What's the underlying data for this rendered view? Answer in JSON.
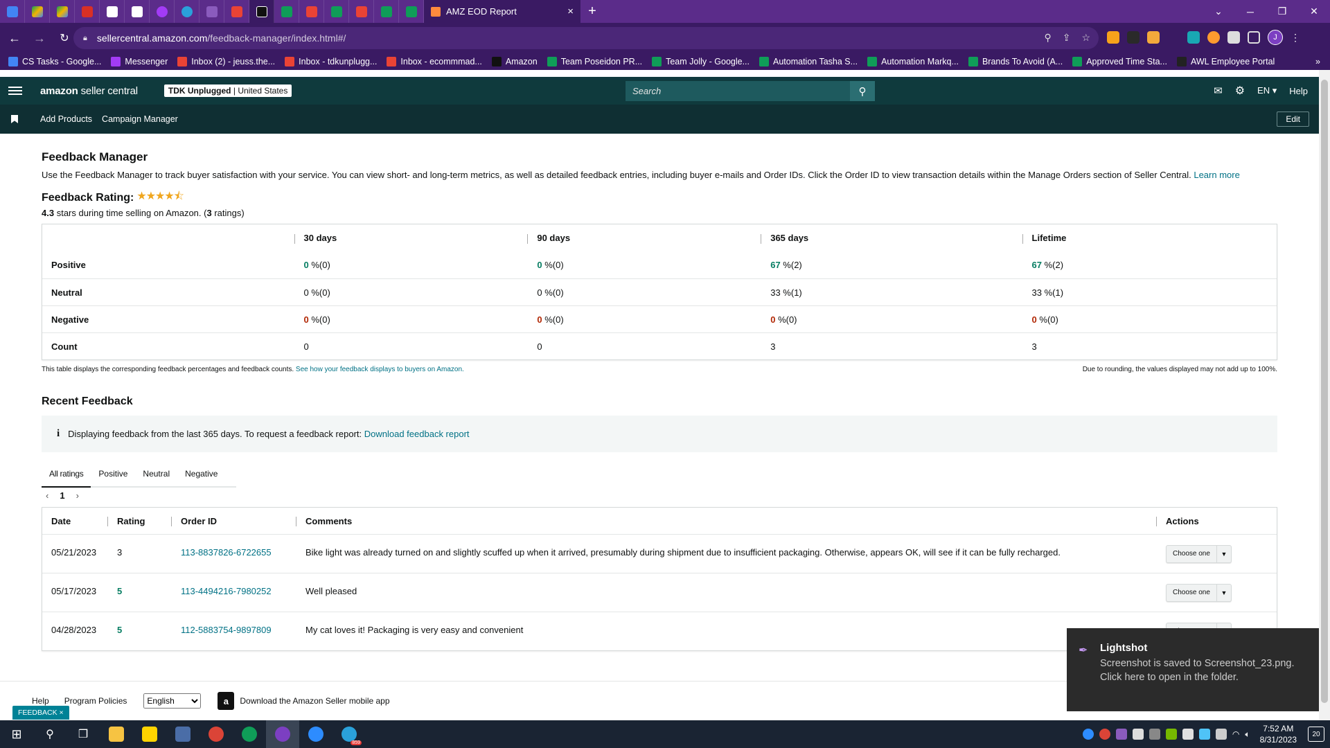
{
  "browser": {
    "active_tab_title": "AMZ EOD Report",
    "url_host": "sellercentral.amazon.com",
    "url_path": "/feedback-manager/index.html#/",
    "bookmarks": [
      {
        "label": "CS Tasks - Google...",
        "icon": "google-docs-icon",
        "color": "#4285f4"
      },
      {
        "label": "Messenger",
        "icon": "messenger-icon",
        "color": "#a33bf6"
      },
      {
        "label": "Inbox (2) - jeuss.the...",
        "icon": "gmail-icon",
        "color": "#ea4335"
      },
      {
        "label": "Inbox - tdkunplugg...",
        "icon": "gmail-icon",
        "color": "#ea4335"
      },
      {
        "label": "Inbox - ecommmad...",
        "icon": "gmail-icon",
        "color": "#ea4335"
      },
      {
        "label": "Amazon",
        "icon": "amazon-icon",
        "color": "#111111"
      },
      {
        "label": "Team Poseidon PR...",
        "icon": "google-sheets-icon",
        "color": "#0f9d58"
      },
      {
        "label": "Team Jolly - Google...",
        "icon": "google-sheets-icon",
        "color": "#0f9d58"
      },
      {
        "label": "Automation Tasha S...",
        "icon": "google-sheets-icon",
        "color": "#0f9d58"
      },
      {
        "label": "Automation Markq...",
        "icon": "google-sheets-icon",
        "color": "#0f9d58"
      },
      {
        "label": "Brands To Avoid (A...",
        "icon": "google-sheets-icon",
        "color": "#0f9d58"
      },
      {
        "label": "Approved Time Sta...",
        "icon": "google-sheets-icon",
        "color": "#0f9d58"
      },
      {
        "label": "AWL Employee Portal",
        "icon": "awl-icon",
        "color": "#222222"
      }
    ],
    "profile_initial": "J"
  },
  "header": {
    "logo_bold": "amazon",
    "logo_rest": " seller central",
    "store_name": "TDK Unplugged",
    "store_region": "United States",
    "search_placeholder": "Search",
    "lang": "EN",
    "help": "Help",
    "nav_links": [
      "Add Products",
      "Campaign Manager"
    ],
    "edit": "Edit"
  },
  "page": {
    "title": "Feedback Manager",
    "description": "Use the Feedback Manager to track buyer satisfaction with your service. You can view short- and long-term metrics, as well as detailed feedback entries, including buyer e-mails and Order IDs. Click the Order ID to view transaction details within the Manage Orders section of Seller Central.",
    "learn_more": "Learn more",
    "rating_label": "Feedback Rating:",
    "stars": "★★★★⯪",
    "rating_value": "4.3",
    "rating_text": "stars during time selling on Amazon. (",
    "rating_count": "3",
    "rating_text_end": " ratings)",
    "rating_stars_value": 4.3
  },
  "metrics": {
    "columns": [
      "30 days",
      "90 days",
      "365 days",
      "Lifetime"
    ],
    "rows": [
      {
        "label": "Positive",
        "cells": [
          {
            "n": "0",
            "rest": " %(0)",
            "tone": "g"
          },
          {
            "n": "0",
            "rest": " %(0)",
            "tone": "g"
          },
          {
            "n": "67",
            "rest": " %(2)",
            "tone": "g"
          },
          {
            "n": "67",
            "rest": " %(2)",
            "tone": "g"
          }
        ]
      },
      {
        "label": "Neutral",
        "cells": [
          {
            "n": "0",
            "rest": " %(0)",
            "tone": ""
          },
          {
            "n": "0",
            "rest": " %(0)",
            "tone": ""
          },
          {
            "n": "33",
            "rest": " %(1)",
            "tone": ""
          },
          {
            "n": "33",
            "rest": " %(1)",
            "tone": ""
          }
        ]
      },
      {
        "label": "Negative",
        "cells": [
          {
            "n": "0",
            "rest": " %(0)",
            "tone": "r"
          },
          {
            "n": "0",
            "rest": " %(0)",
            "tone": "r"
          },
          {
            "n": "0",
            "rest": " %(0)",
            "tone": "r"
          },
          {
            "n": "0",
            "rest": " %(0)",
            "tone": "r"
          }
        ]
      },
      {
        "label": "Count",
        "cells": [
          {
            "n": "0",
            "rest": "",
            "tone": ""
          },
          {
            "n": "0",
            "rest": "",
            "tone": ""
          },
          {
            "n": "3",
            "rest": "",
            "tone": ""
          },
          {
            "n": "3",
            "rest": "",
            "tone": ""
          }
        ]
      }
    ],
    "note_left": "This table displays the corresponding feedback percentages and feedback counts.",
    "note_link": "See how your feedback displays to buyers on Amazon.",
    "note_right": "Due to rounding, the values displayed may not add up to 100%."
  },
  "recent": {
    "title": "Recent Feedback",
    "info_text": "Displaying feedback from the last 365 days. To request a feedback report:",
    "info_link": "Download feedback report",
    "tabs": [
      "All ratings",
      "Positive",
      "Neutral",
      "Negative"
    ],
    "page": "1",
    "headers": [
      "Date",
      "Rating",
      "Order ID",
      "Comments",
      "Actions"
    ],
    "rows": [
      {
        "date": "05/21/2023",
        "rating": "3",
        "order": "113-8837826-6722655",
        "comment": "Bike light was already turned on and slightly scuffed up when it arrived, presumably during shipment due to insufficient packaging. Otherwise, appears OK, will see if it can be fully recharged.",
        "action": "Choose one",
        "positive": false
      },
      {
        "date": "05/17/2023",
        "rating": "5",
        "order": "113-4494216-7980252",
        "comment": "Well pleased",
        "action": "Choose one",
        "positive": true
      },
      {
        "date": "04/28/2023",
        "rating": "5",
        "order": "112-5883754-9897809",
        "comment": "My cat loves it! Packaging is very easy and convenient",
        "action": "Choose one",
        "positive": true
      }
    ]
  },
  "footer": {
    "help": "Help",
    "policies": "Program Policies",
    "language": "English",
    "app": "Download the Amazon Seller mobile app",
    "feedback_tag": "FEEDBACK",
    "feedback_close": "×"
  },
  "toast": {
    "title": "Lightshot",
    "body": "Screenshot is saved to Screenshot_23.png. Click here to open in the folder."
  },
  "taskbar": {
    "time": "7:52 AM",
    "date": "8/31/2023",
    "notifications": "20",
    "telegram_badge": "859"
  },
  "colors": {
    "accent_teal": "#007185",
    "positive": "#067d62",
    "negative": "#b12704",
    "browser_purple": "#5b2c8a",
    "seller_header": "#0f3a3d"
  }
}
